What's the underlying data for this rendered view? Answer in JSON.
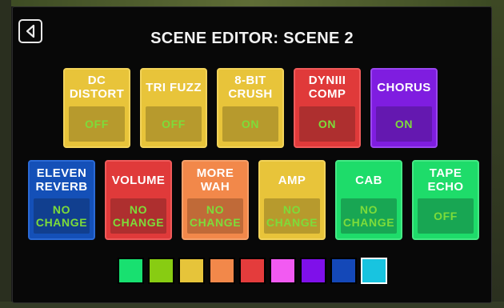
{
  "header": {
    "title": "SCENE EDITOR: SCENE 2"
  },
  "effects_row1": [
    {
      "name": "DC\nDISTORT",
      "state": "OFF",
      "bg": "#e8c43a",
      "border": "#f2d35a",
      "box": "#b79a2d",
      "text": "#7ddc3a"
    },
    {
      "name": "TRI FUZZ",
      "state": "OFF",
      "bg": "#e8c43a",
      "border": "#f2d35a",
      "box": "#b79a2d",
      "text": "#7ddc3a"
    },
    {
      "name": "8-BIT\nCRUSH",
      "state": "ON",
      "bg": "#e8c43a",
      "border": "#f2d35a",
      "box": "#b79a2d",
      "text": "#7ddc3a"
    },
    {
      "name": "DYNIII\nCOMP",
      "state": "ON",
      "bg": "#e03a3a",
      "border": "#ef5a5a",
      "box": "#ae2f2f",
      "text": "#7ddc3a"
    },
    {
      "name": "CHORUS",
      "state": "ON",
      "bg": "#7f1de0",
      "border": "#9a46f0",
      "box": "#6418b0",
      "text": "#7ddc3a"
    }
  ],
  "effects_row2": [
    {
      "name": "ELEVEN\nREVERB",
      "state": "NO\nCHANGE",
      "bg": "#1450b8",
      "border": "#2a6ad6",
      "box": "#113f8f",
      "text": "#7ddc3a"
    },
    {
      "name": "VOLUME",
      "state": "NO\nCHANGE",
      "bg": "#e03a3a",
      "border": "#ef5a5a",
      "box": "#ae2f2f",
      "text": "#7ddc3a"
    },
    {
      "name": "MORE\nWAH",
      "state": "NO\nCHANGE",
      "bg": "#f2884a",
      "border": "#f7a06a",
      "box": "#c06a38",
      "text": "#7ddc3a"
    },
    {
      "name": "AMP",
      "state": "NO\nCHANGE",
      "bg": "#e8c43a",
      "border": "#f2d35a",
      "box": "#b79a2d",
      "text": "#7ddc3a"
    },
    {
      "name": "CAB",
      "state": "NO\nCHANGE",
      "bg": "#1edc6a",
      "border": "#45ea85",
      "box": "#18a653",
      "text": "#7ddc3a"
    },
    {
      "name": "TAPE\nECHO",
      "state": "OFF",
      "bg": "#1edc6a",
      "border": "#45ea85",
      "box": "#18a653",
      "text": "#7ddc3a"
    }
  ],
  "color_swatches": [
    {
      "name": "green",
      "color": "#18e070",
      "selected": false
    },
    {
      "name": "lime",
      "color": "#88cc12",
      "selected": false
    },
    {
      "name": "yellow",
      "color": "#e6c43a",
      "selected": false
    },
    {
      "name": "orange",
      "color": "#f2884a",
      "selected": false
    },
    {
      "name": "red",
      "color": "#e43c3c",
      "selected": false
    },
    {
      "name": "pink",
      "color": "#f25af2",
      "selected": false
    },
    {
      "name": "purple",
      "color": "#7f10ea",
      "selected": false
    },
    {
      "name": "blue",
      "color": "#1448b8",
      "selected": false
    },
    {
      "name": "cyan",
      "color": "#18c4e0",
      "selected": true
    }
  ],
  "icons": {
    "back": "back-arrow-icon"
  }
}
